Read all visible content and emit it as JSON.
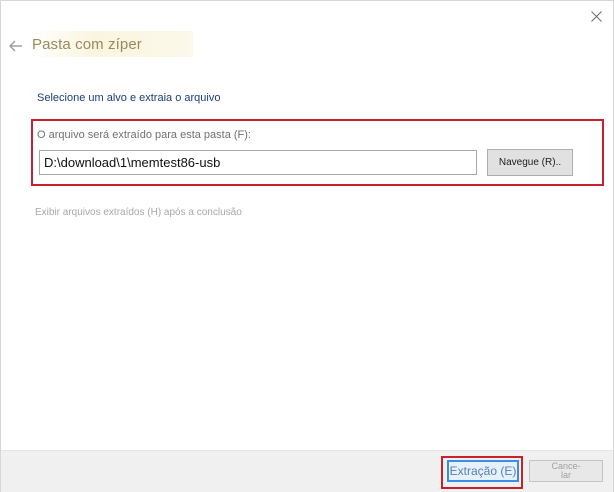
{
  "dialog": {
    "title": "Pasta com zíper",
    "instruction": "Selecione um alvo e extraia o arquivo",
    "path_label": "O arquivo será extraído para esta pasta (F):",
    "path_value": "D:\\download\\1\\memtest86-usb",
    "browse_label": "Navegue (R)..",
    "show_files_label": "Exibir arquivos extraídos (H) após a conclusão"
  },
  "footer": {
    "extract_label": "Extração (E)",
    "cancel_label": "Cance-\nlar"
  },
  "icons": {
    "back": "back-arrow-icon",
    "close": "close-icon"
  },
  "colors": {
    "highlight": "#c8202c",
    "title": "#9a8a5a",
    "instruction": "#1b3d7a",
    "focus_border": "#3a8ee6"
  }
}
